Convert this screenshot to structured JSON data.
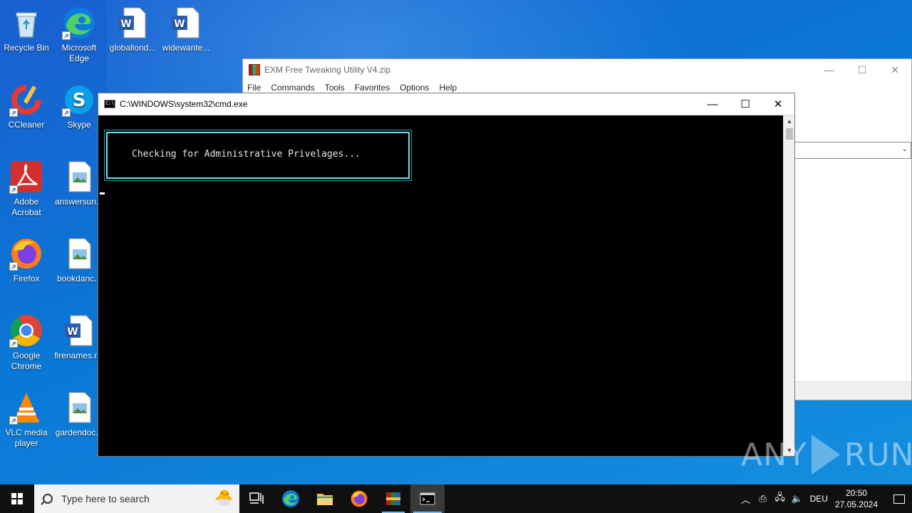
{
  "desktop": {
    "icons": [
      {
        "label": "Recycle Bin",
        "icon": "recycle-bin-icon"
      },
      {
        "label": "Microsoft Edge",
        "icon": "edge-icon"
      },
      {
        "label": "globallond...",
        "icon": "word-doc-icon"
      },
      {
        "label": "widewante...",
        "icon": "word-doc-icon"
      },
      {
        "label": "CCleaner",
        "icon": "ccleaner-icon"
      },
      {
        "label": "Skype",
        "icon": "skype-icon"
      },
      {
        "label": "Adobe Acrobat",
        "icon": "acrobat-icon"
      },
      {
        "label": "answersun...",
        "icon": "image-file-icon"
      },
      {
        "label": "Firefox",
        "icon": "firefox-icon"
      },
      {
        "label": "bookdanc...",
        "icon": "image-file-icon"
      },
      {
        "label": "Google Chrome",
        "icon": "chrome-icon"
      },
      {
        "label": "firenames.r...",
        "icon": "word-doc-icon"
      },
      {
        "label": "VLC media player",
        "icon": "vlc-icon"
      },
      {
        "label": "gardendoc...",
        "icon": "image-file-icon"
      }
    ]
  },
  "winrar": {
    "title": "EXM Free Tweaking Utility V4.zip",
    "menu": [
      "File",
      "Commands",
      "Tools",
      "Favorites",
      "Options",
      "Help"
    ]
  },
  "cmd": {
    "title": "C:\\WINDOWS\\system32\\cmd.exe",
    "message": "Checking for Administrative Privelages..."
  },
  "watermark": {
    "left": "ANY",
    "right": "RUN"
  },
  "taskbar": {
    "search_placeholder": "Type here to search",
    "apps": [
      "task-view",
      "edge",
      "file-explorer",
      "firefox",
      "winrar",
      "cmd"
    ],
    "language": "DEU",
    "time": "20:50",
    "date": "27.05.2024"
  },
  "colors": {
    "desktop_blue": "#0a78d6",
    "console_bg": "#000000",
    "console_box_border": "#7fd7e8",
    "taskbar_bg": "#101010"
  }
}
